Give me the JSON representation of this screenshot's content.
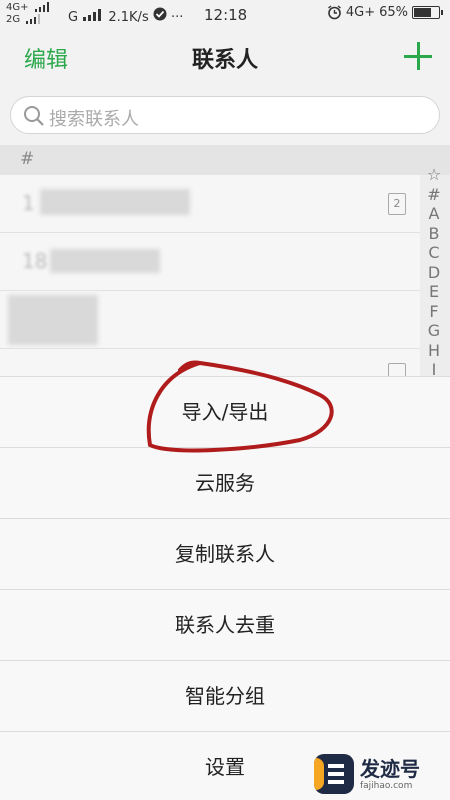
{
  "status_bar": {
    "network_top": "4G+",
    "network_bottom": "2G",
    "network_secondary": "G",
    "speed": "2.1K/s",
    "more": "···",
    "time": "12:18",
    "network_right": "4G+",
    "battery_percent": "65%",
    "battery_level": 0.65
  },
  "header": {
    "edit_label": "编辑",
    "title": "联系人",
    "add_icon": "plus-icon"
  },
  "search": {
    "placeholder": "搜索联系人",
    "icon": "search-icon"
  },
  "list": {
    "section_label": "#",
    "rows": [
      {
        "text": "1",
        "sim_badge": "2"
      },
      {
        "text": "18",
        "sim_badge": ""
      },
      {
        "text": "",
        "sim_badge": ""
      }
    ]
  },
  "alphabet_index": [
    "☆",
    "#",
    "A",
    "B",
    "C",
    "D",
    "E",
    "F",
    "G",
    "H",
    "I"
  ],
  "action_sheet": {
    "items": [
      "导入/导出",
      "云服务",
      "复制联系人",
      "联系人去重",
      "智能分组",
      "设置"
    ]
  },
  "watermark": {
    "title": "发迹号",
    "subtitle": "fajihao.com"
  },
  "colors": {
    "accent": "#2aa84a",
    "annotation": "#b01c1c"
  }
}
